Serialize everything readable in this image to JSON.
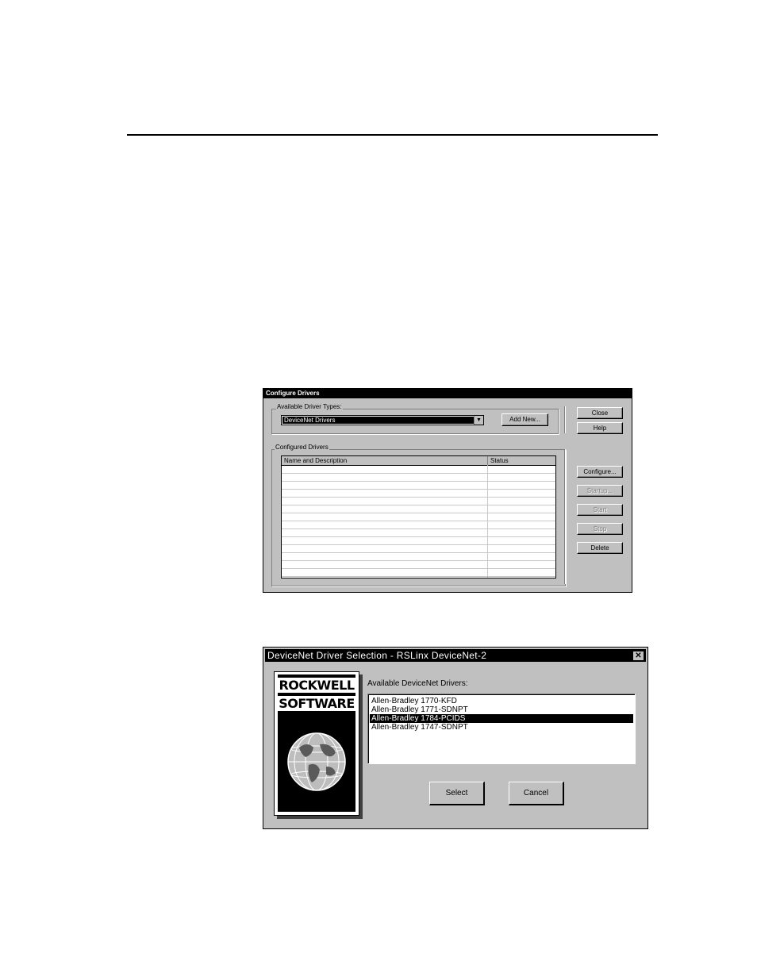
{
  "configure_drivers": {
    "title": "Configure Drivers",
    "available_label": "Available Driver Types:",
    "selected_type": "DeviceNet Drivers",
    "add_new_label": "Add New...",
    "configured_label": "Configured Drivers",
    "columns": [
      "Name and Description",
      "Status"
    ],
    "buttons": {
      "close": "Close",
      "help": "Help",
      "configure": "Configure...",
      "startup": "Startup...",
      "start": "Start",
      "stop": "Stop",
      "delete": "Delete"
    }
  },
  "driver_selection": {
    "title": "DeviceNet Driver Selection - RSLinx DeviceNet-2",
    "logo_line1": "ROCKWELL",
    "logo_line2": "SOFTWARE",
    "list_label": "Available DeviceNet Drivers:",
    "drivers": [
      "Allen-Bradley 1770-KFD",
      "Allen-Bradley 1771-SDNPT",
      "Allen-Bradley 1784-PCIDS",
      "Allen-Bradley 1747-SDNPT"
    ],
    "selected_index": 2,
    "select_label": "Select",
    "cancel_label": "Cancel"
  }
}
